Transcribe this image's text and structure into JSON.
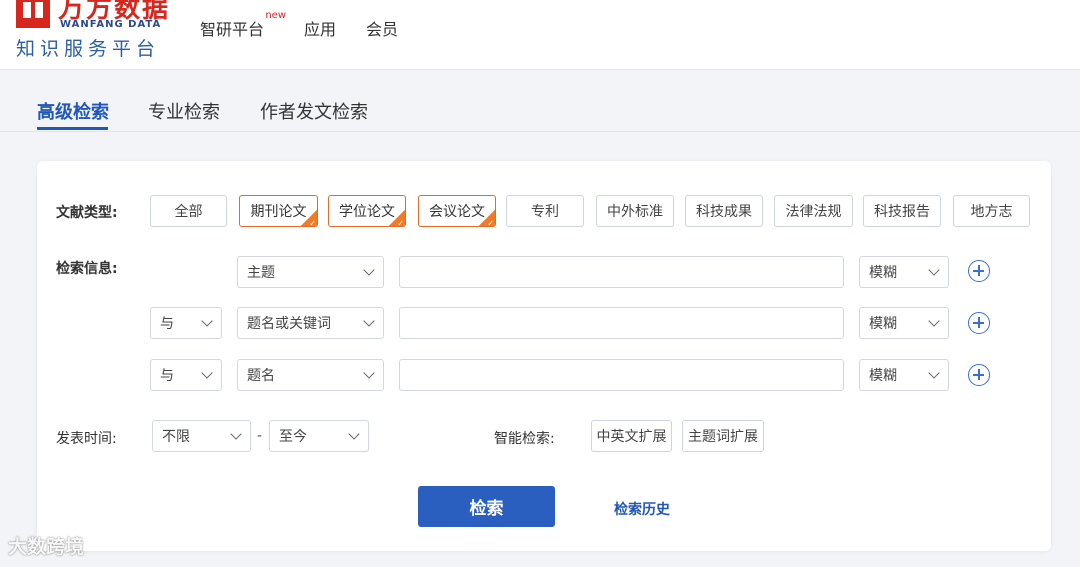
{
  "brand": {
    "name_cn": "万方数据",
    "name_en": "WANFANG DATA",
    "tagline": "知识服务平台"
  },
  "nav": {
    "items": [
      {
        "label": "智研平台",
        "badge": "new"
      },
      {
        "label": "应用"
      },
      {
        "label": "会员"
      }
    ]
  },
  "tabs": [
    {
      "label": "高级检索",
      "active": true
    },
    {
      "label": "专业检索"
    },
    {
      "label": "作者发文检索"
    }
  ],
  "doc_types": {
    "label": "文献类型:",
    "items": [
      {
        "label": "全部",
        "selected": false
      },
      {
        "label": "期刊论文",
        "selected": true
      },
      {
        "label": "学位论文",
        "selected": true
      },
      {
        "label": "会议论文",
        "selected": true
      },
      {
        "label": "专利",
        "selected": false
      },
      {
        "label": "中外标准",
        "selected": false
      },
      {
        "label": "科技成果",
        "selected": false
      },
      {
        "label": "法律法规",
        "selected": false
      },
      {
        "label": "科技报告",
        "selected": false
      },
      {
        "label": "地方志",
        "selected": false
      }
    ]
  },
  "search_info": {
    "label": "检索信息:",
    "rows": [
      {
        "logic": "",
        "field": "主题",
        "value": "",
        "match": "模糊"
      },
      {
        "logic": "与",
        "field": "题名或关键词",
        "value": "",
        "match": "模糊"
      },
      {
        "logic": "与",
        "field": "题名",
        "value": "",
        "match": "模糊"
      }
    ]
  },
  "date": {
    "label": "发表时间:",
    "from": "不限",
    "separator": "-",
    "to": "至今"
  },
  "smart": {
    "label": "智能检索:",
    "options": [
      "中英文扩展",
      "主题词扩展"
    ]
  },
  "actions": {
    "search": "检索",
    "history": "检索历史"
  },
  "watermark": "大数跨境",
  "colors": {
    "primary": "#2a5fbf",
    "selected_border": "#e06c2a",
    "brand_red": "#d7261e"
  }
}
